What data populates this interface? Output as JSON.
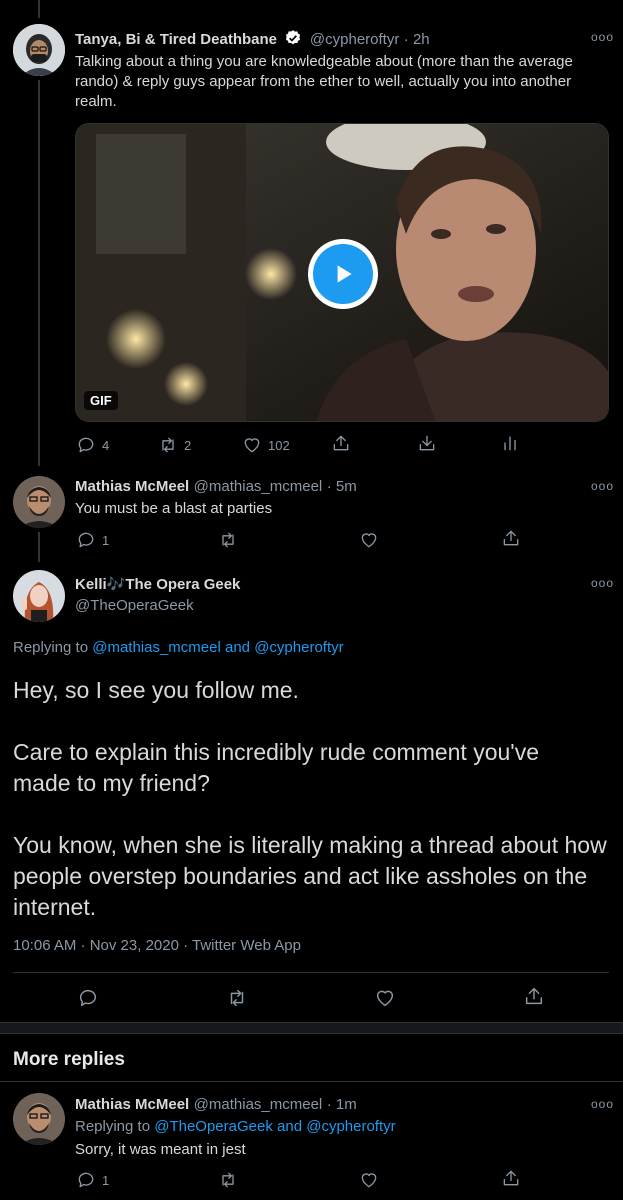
{
  "tweet1": {
    "name": "Tanya, Bi & Tired Deathbane",
    "handle": "@cypheroftyr",
    "time": "· 2h",
    "text": "Talking about a thing you are knowledgeable about (more than the average rando) & reply guys appear from the ether to well, actually you into another realm.",
    "media_badge": "GIF",
    "replies": "4",
    "retweets": "2",
    "likes": "102",
    "more": "ooo"
  },
  "tweet2": {
    "name": "Mathias McMeel",
    "handle": "@mathias_mcmeel",
    "time": "· 5m",
    "text": "You must be a blast at parties",
    "replies": "1",
    "more": "ooo"
  },
  "main_tweet": {
    "name": "Kelli🎶The Opera Geek",
    "handle": "@TheOperaGeek",
    "replying_prefix": "Replying to ",
    "replying_user1": "@mathias_mcmeel",
    "replying_and": " and ",
    "replying_user2": "@cypheroftyr",
    "para1": "Hey, so I see you follow me.",
    "para2": "Care to explain this incredibly rude comment you've made to my friend?",
    "para3": "You know, when she is literally making a thread about how people overstep boundaries and act like assholes on the internet.",
    "meta": "10:06 AM · Nov 23, 2020 · Twitter Web App",
    "more": "ooo"
  },
  "section": {
    "more_replies": "More replies"
  },
  "tweet3": {
    "name": "Mathias McMeel",
    "handle": "@mathias_mcmeel",
    "time": "· 1m",
    "replying_prefix": "Replying to ",
    "replying_user1": "@TheOperaGeek",
    "replying_and": " and ",
    "replying_user2": "@cypheroftyr",
    "text": "Sorry, it was meant in jest",
    "replies": "1",
    "more": "ooo"
  },
  "colors": {
    "background": "#000000",
    "link": "#1d9bf0",
    "muted": "#8b98a5",
    "play_button": "#1d9bf0",
    "verified": "#ffffff"
  }
}
